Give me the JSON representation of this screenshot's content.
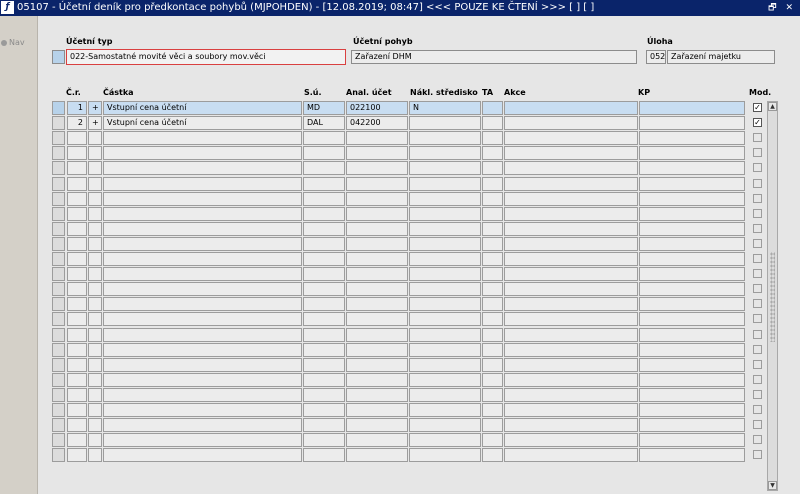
{
  "window": {
    "title": "05107 - Účetní deník pro předkontace pohybů (MJPOHDEN) - [12.08.2019; 08:47] <<< POUZE KE ČTENÍ >>>  [ ]  [ ]",
    "app_icon": "ƒ",
    "controls": "🗗 ✕"
  },
  "nav": {
    "label": "Nav",
    "icon": "nav-dot-icon"
  },
  "header": {
    "ucetni_typ": {
      "label": "Účetní typ",
      "value": "022-Samostatné movité věci a soubory mov.věci"
    },
    "ucetni_pohyb": {
      "label": "Účetní pohyb",
      "value": "Zařazení DHM"
    },
    "uloha": {
      "label": "Úloha",
      "code": "052",
      "value": "Zařazení majetku"
    }
  },
  "columns": [
    "Č.r.",
    "Částka",
    "S.ú.",
    "Anal. účet",
    "Nákl. středisko",
    "TA",
    "Akce",
    "KP",
    "Mod."
  ],
  "rows": [
    {
      "cr": "1",
      "sign": "+",
      "castka": "Vstupní cena účetní",
      "su": "MD",
      "anal": "022100",
      "nakl": "N",
      "ta": "",
      "akce": "",
      "kp": "",
      "mod": true
    },
    {
      "cr": "2",
      "sign": "+",
      "castka": "Vstupní cena účetní",
      "su": "DAL",
      "anal": "042200",
      "nakl": "",
      "ta": "",
      "akce": "",
      "kp": "",
      "mod": true
    }
  ],
  "empty_rows": 22
}
